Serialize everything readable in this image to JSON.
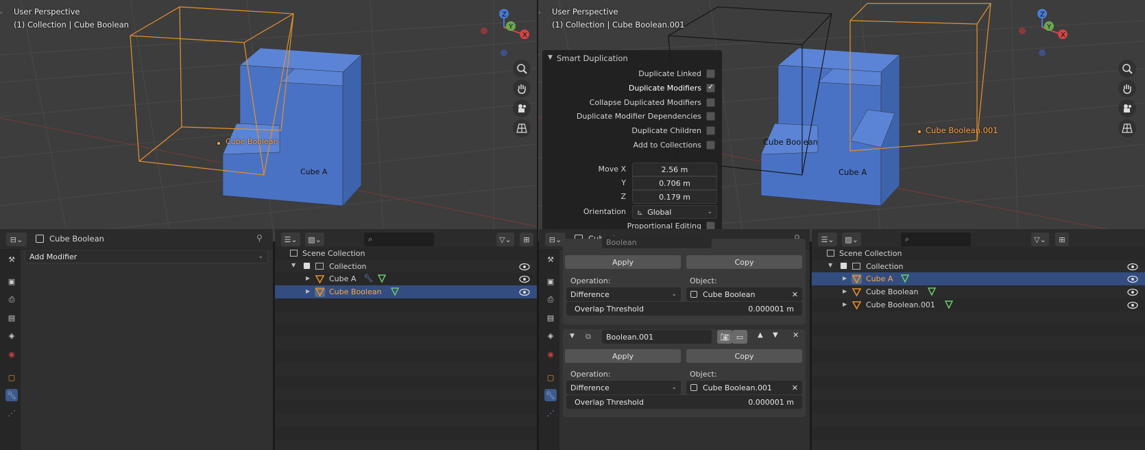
{
  "left_viewport": {
    "view_name": "User Perspective",
    "context": "(1) Collection | Cube Boolean",
    "labels": {
      "cube_boolean": "Cube Boolean",
      "cube_a": "Cube A"
    }
  },
  "right_viewport": {
    "view_name": "User Perspective",
    "context": "(1) Collection | Cube Boolean.001",
    "labels": {
      "cube_boolean": "Cube Boolean",
      "cube_a": "Cube A",
      "cube_boolean_001": "Cube Boolean.001"
    }
  },
  "gizmo": {
    "z": "Z",
    "y": "Y",
    "x": "X"
  },
  "smart_duplication": {
    "title": "Smart Duplication",
    "options": [
      {
        "label": "Duplicate Linked",
        "checked": false
      },
      {
        "label": "Duplicate Modifiers",
        "checked": true
      },
      {
        "label": "Collapse Duplicated Modifiers",
        "checked": false
      },
      {
        "label": "Duplicate Modifier Dependencies",
        "checked": false
      },
      {
        "label": "Duplicate Children",
        "checked": false
      },
      {
        "label": "Add to Collections",
        "checked": false
      }
    ],
    "move_label": "Move X",
    "y_label": "Y",
    "z_label": "Z",
    "move_x": "2.56 m",
    "move_y": "0.706 m",
    "move_z": "0.179 m",
    "orientation_label": "Orientation",
    "orientation_value": "Global",
    "proportional_label": "Proportional Editing",
    "proportional_checked": false
  },
  "left_properties": {
    "object_name": "Cube Boolean",
    "add_modifier": "Add Modifier"
  },
  "left_outliner": {
    "root": "Scene Collection",
    "collection": "Collection",
    "items": [
      {
        "name": "Cube A",
        "selected": false,
        "has_modifier": true
      },
      {
        "name": "Cube Boolean",
        "selected": true,
        "has_modifier": false
      }
    ]
  },
  "right_properties": {
    "object_name": "Cube A",
    "partial_name": "Boolean",
    "mod1": {
      "apply": "Apply",
      "copy": "Copy",
      "operation_label": "Operation:",
      "object_label": "Object:",
      "operation": "Difference",
      "object": "Cube Boolean",
      "threshold_label": "Overlap Threshold",
      "threshold": "0.000001 m"
    },
    "mod2": {
      "name": "Boolean.001",
      "apply": "Apply",
      "copy": "Copy",
      "operation_label": "Operation:",
      "object_label": "Object:",
      "operation": "Difference",
      "object": "Cube Boolean.001",
      "threshold_label": "Overlap Threshold",
      "threshold": "0.000001 m"
    }
  },
  "right_outliner": {
    "root": "Scene Collection",
    "collection": "Collection",
    "items": [
      {
        "name": "Cube A",
        "selected": true
      },
      {
        "name": "Cube Boolean",
        "selected": false
      },
      {
        "name": "Cube Boolean.001",
        "selected": false
      }
    ]
  },
  "colors": {
    "accent_orange": "#ffa544",
    "selected_row": "#334d80",
    "cube_blue": "#4a72c4"
  }
}
